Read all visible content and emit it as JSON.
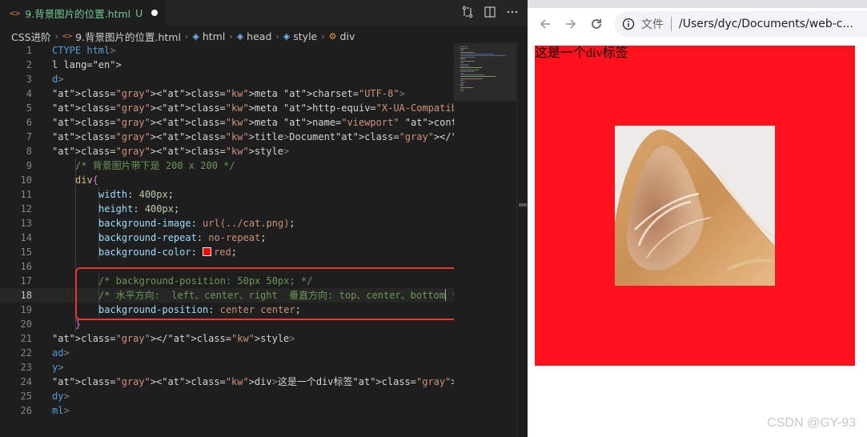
{
  "editor": {
    "tab": {
      "icon": "html-file-icon",
      "filename": "9.背景图片的位置.html",
      "status": "U"
    },
    "breadcrumb": [
      "CSS进阶",
      "9.背景图片的位置.html",
      "html",
      "head",
      "style",
      "div"
    ],
    "lines": [
      {
        "n": "1",
        "text": "CTYPE html>"
      },
      {
        "n": "2",
        "text": "l lang=\"en\">"
      },
      {
        "n": "3",
        "text": "d>"
      },
      {
        "n": "4",
        "text": "<meta charset=\"UTF-8\">"
      },
      {
        "n": "5",
        "text": "<meta http-equiv=\"X-UA-Compatible\" content=\"IE=edge\">"
      },
      {
        "n": "6",
        "text": "<meta name=\"viewport\" content=\"width=device-width, initial-scale=1.0\">"
      },
      {
        "n": "7",
        "text": "<title>Document</title>"
      },
      {
        "n": "8",
        "text": "<style>"
      },
      {
        "n": "9",
        "text": "/* 背景图片带下是 200 x 200 */"
      },
      {
        "n": "10",
        "text": "div{"
      },
      {
        "n": "11",
        "text": "width: 400px;"
      },
      {
        "n": "12",
        "text": "height: 400px;"
      },
      {
        "n": "13",
        "text": "background-image: url(../cat.png);"
      },
      {
        "n": "14",
        "text": "background-repeat: no-repeat;"
      },
      {
        "n": "15",
        "text": "background-color: red;"
      },
      {
        "n": "16",
        "text": ""
      },
      {
        "n": "17",
        "text": "/* background-position: 50px 50px; */"
      },
      {
        "n": "18",
        "text": "/* 水平方向:  left、center、right  垂直方向: top、center、bottom */"
      },
      {
        "n": "19",
        "text": "background-position: center center;"
      },
      {
        "n": "20",
        "text": "}"
      },
      {
        "n": "21",
        "text": "</style>"
      },
      {
        "n": "22",
        "text": "ad>"
      },
      {
        "n": "23",
        "text": "y>"
      },
      {
        "n": "24",
        "text": "<div>这是一个div标签</div>"
      },
      {
        "n": "25",
        "text": "dy>"
      },
      {
        "n": "26",
        "text": "ml>"
      }
    ]
  },
  "browser": {
    "address": {
      "scheme_label": "文件",
      "url": "/Users/dyc/Documents/web-c..."
    },
    "page": {
      "div_text": "这是一个div标签",
      "div_bg_color": "#ff101d"
    }
  },
  "watermark": "CSDN @GY-93",
  "colors": {
    "accent_red_box": "#e53935",
    "tab_modified": "#73c991"
  }
}
